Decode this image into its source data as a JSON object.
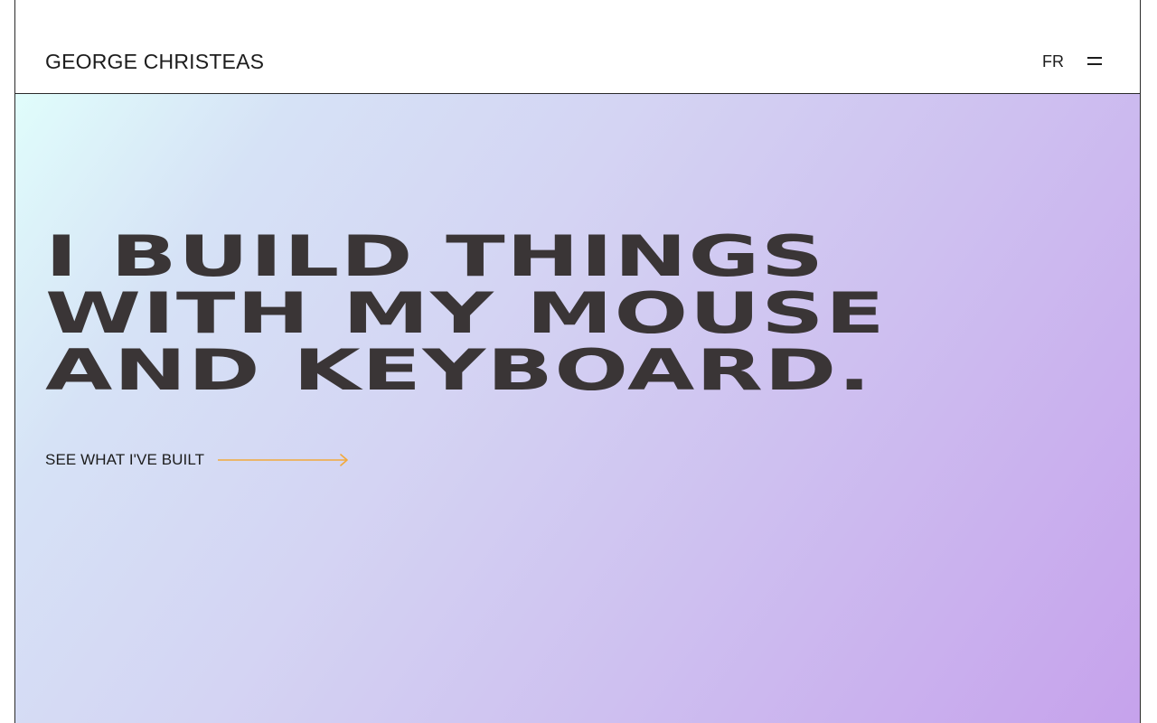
{
  "header": {
    "brand": "GEORGE CHRISTEAS",
    "language": "FR",
    "menu_icon": "hamburger-menu-icon"
  },
  "hero": {
    "headline_lines": [
      "I BUILD THINGS",
      "WITH MY MOUSE",
      "AND KEYBOARD."
    ],
    "cta_label": "SEE WHAT I'VE BUILT",
    "cta_icon": "arrow-right-icon"
  },
  "colors": {
    "text": "#1c1c1c",
    "headline": "#3a3536",
    "accent_arrow": "#f2a93b",
    "gradient_start": "#e0fdfb",
    "gradient_end": "#c6a2ec"
  }
}
